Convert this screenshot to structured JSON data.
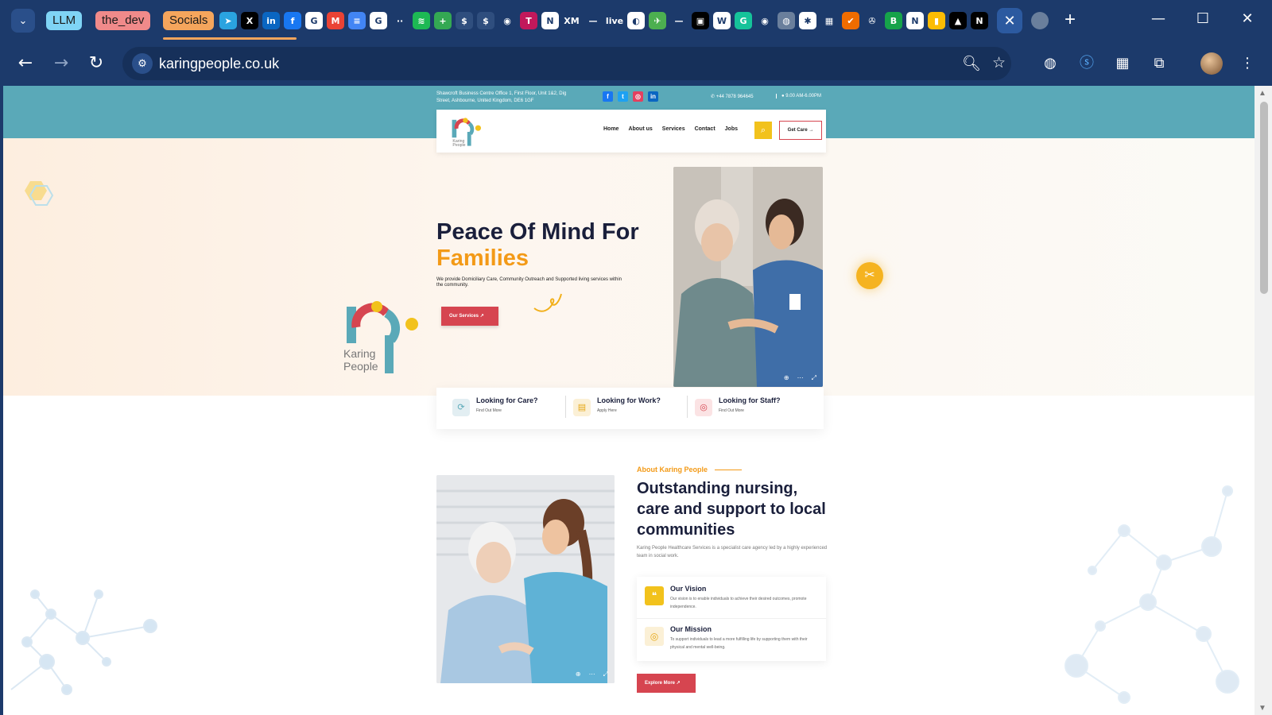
{
  "browser": {
    "tab_groups": [
      "LLM",
      "the_dev",
      "Socials"
    ],
    "favicons": [
      {
        "icon": "telegram-icon",
        "glyph": "➤",
        "color": "#2aa3e0"
      },
      {
        "icon": "x-icon",
        "glyph": "X",
        "color": "#000000"
      },
      {
        "icon": "linkedin-icon",
        "glyph": "in",
        "color": "#0a66c2"
      },
      {
        "icon": "facebook-icon",
        "glyph": "f",
        "color": "#1877f2"
      },
      {
        "icon": "google-icon",
        "glyph": "G",
        "color": "#ffffff"
      },
      {
        "icon": "gmail-icon",
        "glyph": "M",
        "color": "#ea4335"
      },
      {
        "icon": "docs-icon",
        "glyph": "≡",
        "color": "#4285f4"
      },
      {
        "icon": "google-icon",
        "glyph": "G",
        "color": "#ffffff"
      },
      {
        "icon": "more-dots-icon",
        "glyph": "··",
        "color": "#1c3a6b"
      },
      {
        "icon": "spotify-icon",
        "glyph": "≋",
        "color": "#1db954"
      },
      {
        "icon": "sheets-plus-icon",
        "glyph": "+",
        "color": "#34a853"
      },
      {
        "icon": "dollar-icon",
        "glyph": "$",
        "color": "#2f4e7e"
      },
      {
        "icon": "dollar-icon",
        "glyph": "$",
        "color": "#2f4e7e"
      },
      {
        "icon": "github-icon",
        "glyph": "◉",
        "color": "#1c3a6b"
      },
      {
        "icon": "the-icon",
        "glyph": "T",
        "color": "#c2185b"
      },
      {
        "icon": "notion-icon",
        "glyph": "N",
        "color": "#ffffff"
      },
      {
        "icon": "xm-icon",
        "glyph": "XM",
        "color": "#1c3a6b"
      },
      {
        "icon": "dash-icon",
        "glyph": "—",
        "color": "#1c3a6b"
      },
      {
        "icon": "live-icon",
        "glyph": "live",
        "color": "#1c3a6b"
      },
      {
        "icon": "circle-g-icon",
        "glyph": "◐",
        "color": "#ffffff"
      },
      {
        "icon": "rocket-icon",
        "glyph": "✈",
        "color": "#4caf50"
      },
      {
        "icon": "dash-icon",
        "glyph": "—",
        "color": "#1c3a6b"
      },
      {
        "icon": "cube-icon",
        "glyph": "▣",
        "color": "#000000"
      },
      {
        "icon": "wikipedia-icon",
        "glyph": "W",
        "color": "#ffffff"
      },
      {
        "icon": "grammarly-icon",
        "glyph": "G",
        "color": "#15c39a"
      },
      {
        "icon": "github-icon",
        "glyph": "◉",
        "color": "#1c3a6b"
      },
      {
        "icon": "globe-icon",
        "glyph": "◍",
        "color": "#6a7f9c"
      },
      {
        "icon": "snowflake-icon",
        "glyph": "✱",
        "color": "#ffffff"
      },
      {
        "icon": "grid-icon",
        "glyph": "▦",
        "color": "#1c3a6b"
      },
      {
        "icon": "checkmark-icon",
        "glyph": "✔",
        "color": "#ef6c00"
      },
      {
        "icon": "steering-icon",
        "glyph": "✇",
        "color": "#1c3a6b"
      },
      {
        "icon": "b-icon",
        "glyph": "B",
        "color": "#16a34a"
      },
      {
        "icon": "notion-icon",
        "glyph": "N",
        "color": "#ffffff"
      },
      {
        "icon": "chart-icon",
        "glyph": "▮",
        "color": "#fbbc04"
      },
      {
        "icon": "triangle-icon",
        "glyph": "▲",
        "color": "#000000"
      },
      {
        "icon": "n-icon",
        "glyph": "N",
        "color": "#000000"
      }
    ],
    "close_tab": "✕",
    "new_tab": "+",
    "url": "karingpeople.co.uk"
  },
  "site": {
    "address": "Shawcroft Business Centre Office 1, First Floor, Unit 1&2, Dig Street, Ashbourne, United Kingdom, DE6 1GF",
    "phone": "+44 7878 964645",
    "hours": "9.00 AM-6.00PM",
    "socials": [
      {
        "icon": "facebook-icon",
        "glyph": "f",
        "color": "#1877f2"
      },
      {
        "icon": "twitter-icon",
        "glyph": "t",
        "color": "#1da1f2"
      },
      {
        "icon": "instagram-icon",
        "glyph": "◎",
        "color": "#e4405f"
      },
      {
        "icon": "linkedin-icon",
        "glyph": "in",
        "color": "#0a66c2"
      }
    ],
    "logo_small_text": "Karing People",
    "logo_text_1": "Karing",
    "logo_text_2": "People",
    "nav": [
      "Home",
      "About us",
      "Services",
      "Contact",
      "Jobs"
    ],
    "get_care": "Get Care →",
    "hero": {
      "title_1": "Peace Of Mind For",
      "title_2": "Families",
      "subtitle": "We provide Domiciliary Care, Community Outreach and Supported living services within the community.",
      "button": "Our Services ↗"
    },
    "cards": [
      {
        "title": "Looking for Care?",
        "sub": "Find Out More",
        "icon": "refresh-icon",
        "glyph": "⟳",
        "bg": "#e2eef2",
        "fg": "#5aa9b8"
      },
      {
        "title": "Looking for Work?",
        "sub": "Apply Here",
        "icon": "briefcase-icon",
        "glyph": "▤",
        "bg": "#fbf0d6",
        "fg": "#e6a817"
      },
      {
        "title": "Looking for Staff?",
        "sub": "Find Out More",
        "icon": "search-person-icon",
        "glyph": "◎",
        "bg": "#fbe3e4",
        "fg": "#d64550"
      }
    ],
    "about": {
      "tag": "About Karing People",
      "title": "Outstanding nursing, care and support to local communities",
      "description": "Karing People Healthcare Services is a specialist care agency led by a highly experienced team in social work.",
      "vision_title": "Our Vision",
      "vision_text": "Our vision is to enable individuals to achieve their desired outcomes, promote independence.",
      "mission_title": "Our Mission",
      "mission_text": "To support individuals to lead a more fulfilling life by supporting them with their physical and mental well-being.",
      "button": "Explore More ↗"
    },
    "colors": {
      "teal": "#5aa9b8",
      "orange": "#f39a17",
      "red": "#d64550",
      "yellow": "#f2c21c",
      "navy": "#1a1f3b"
    }
  }
}
